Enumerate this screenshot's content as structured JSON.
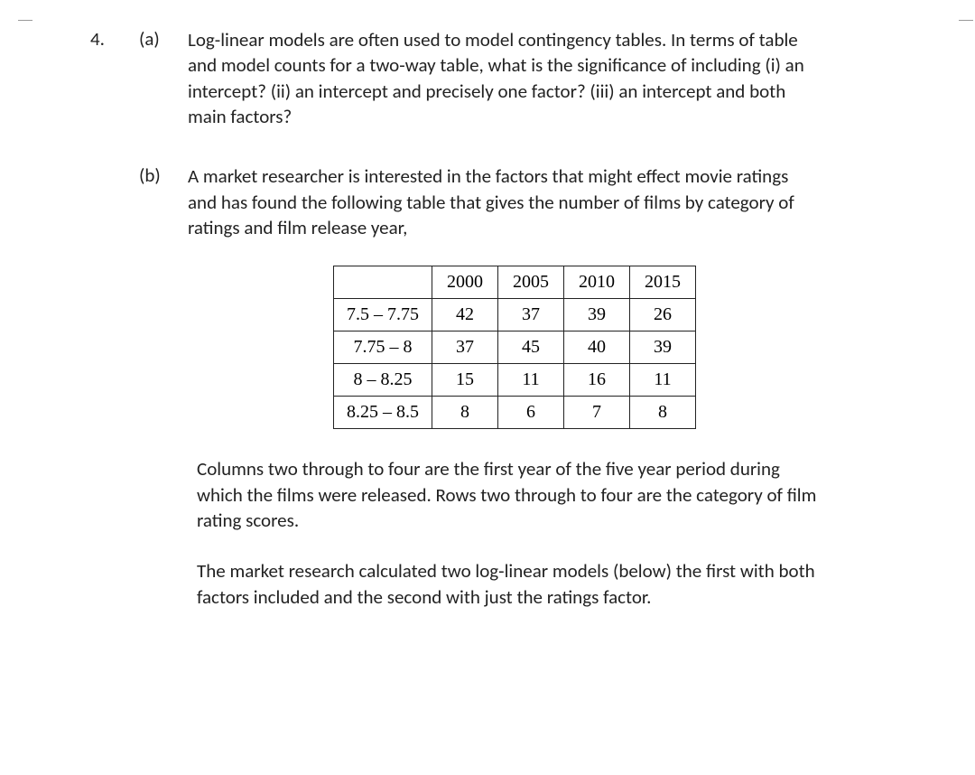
{
  "question": {
    "number": "4.",
    "parts": {
      "a": {
        "label": "(a)",
        "text": "Log-linear models are often used to model contingency tables. In terms of table and model counts for a two-way table, what is the significance of including (i) an intercept? (ii) an intercept and precisely one factor? (iii) an intercept and both main factors?"
      },
      "b": {
        "label": "(b)",
        "intro": "A market researcher is interested in the factors that might effect movie ratings and has found the following table that gives the number of films by category of ratings and film release year,",
        "table": {
          "col_headers": [
            "2000",
            "2005",
            "2010",
            "2015"
          ],
          "rows": [
            {
              "label": "7.5 – 7.75",
              "cells": [
                "42",
                "37",
                "39",
                "26"
              ]
            },
            {
              "label": "7.75 – 8",
              "cells": [
                "37",
                "45",
                "40",
                "39"
              ]
            },
            {
              "label": "8 – 8.25",
              "cells": [
                "15",
                "11",
                "16",
                "11"
              ]
            },
            {
              "label": "8.25 – 8.5",
              "cells": [
                "8",
                "6",
                "7",
                "8"
              ]
            }
          ]
        },
        "para1": "Columns two through to four are the first year of the five year period during which the films were released. Rows two through to four are the category of film rating scores.",
        "para2": "The market research calculated two log-linear models (below) the first with both factors included and the second with just the ratings factor."
      }
    }
  }
}
